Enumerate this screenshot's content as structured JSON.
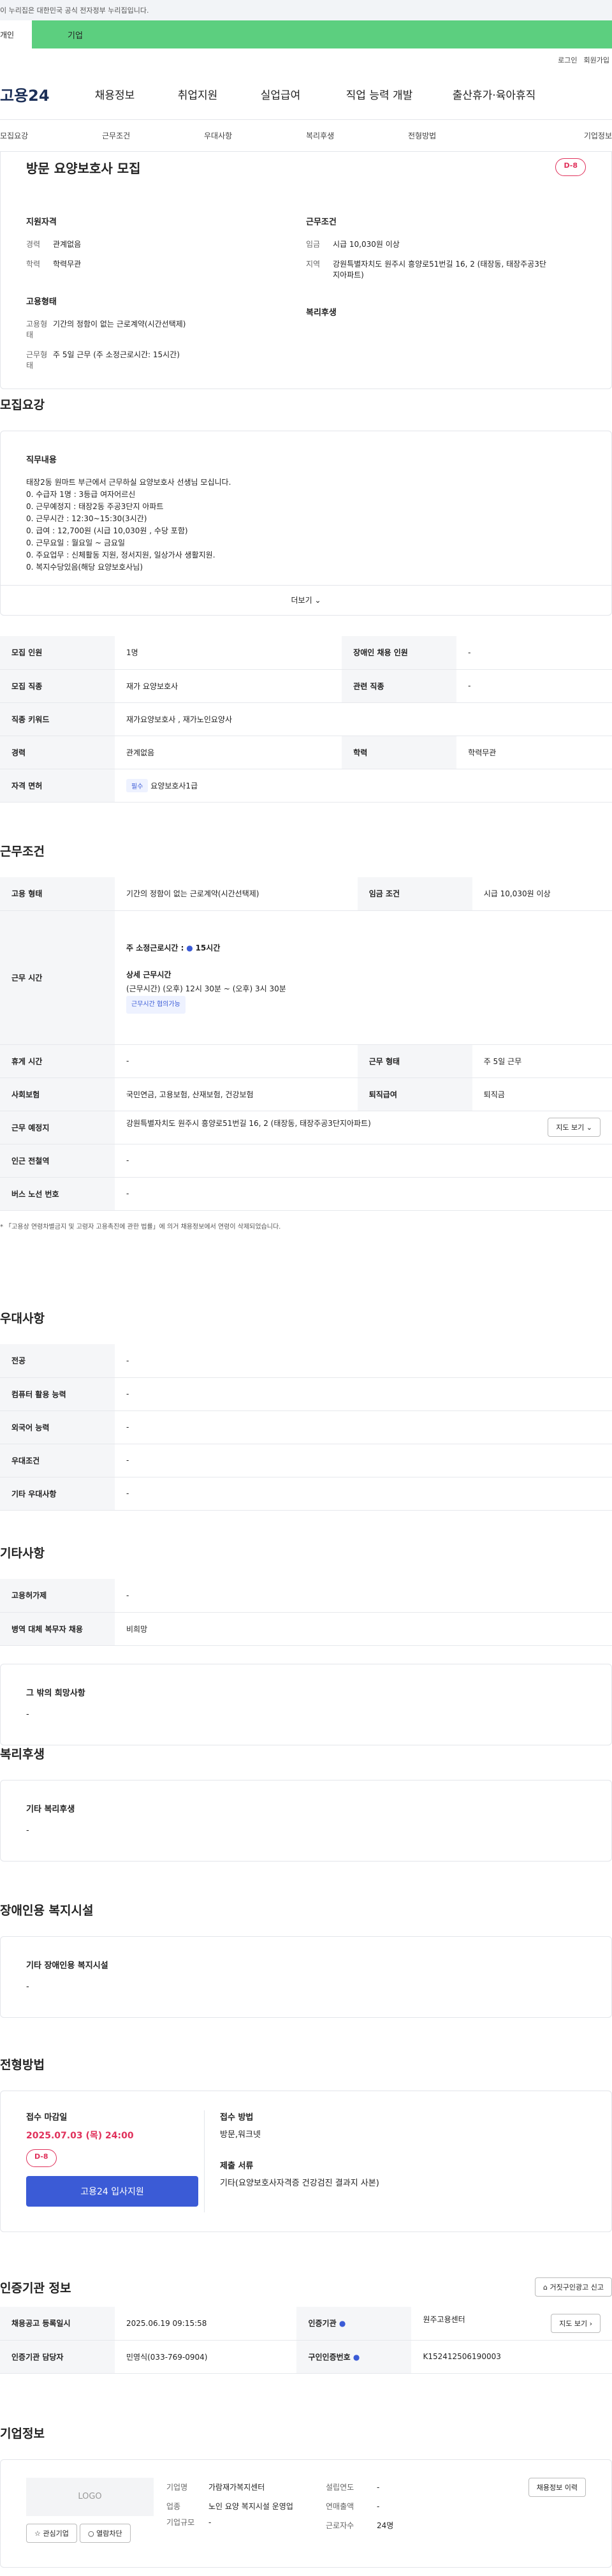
{
  "gov_banner": "이 누리집은 대한민국 공식 전자정부 누리집입니다.",
  "audience": {
    "personal": "개인",
    "company": "기업"
  },
  "util": [
    "로그인",
    "회원가입"
  ],
  "logo": "고용24",
  "gnb": [
    "채용정보",
    "취업지원",
    "실업급여",
    "직업 능력 개발",
    "출산휴가·육아휴직"
  ],
  "snb": [
    "모집요강",
    "근무조건",
    "우대사항",
    "복리후생",
    "전형방법",
    "기업정보"
  ],
  "job": {
    "title": "방문 요양보호사 모집",
    "dday": "D-8",
    "qual_title": "지원자격",
    "career_k": "경력",
    "career": "관계없음",
    "edu_k": "학력",
    "edu": "학력무관",
    "cond_title": "근무조건",
    "wage_k": "임금",
    "wage": "시급 10,030원 이상",
    "region_k": "지역",
    "region": "강원특별자치도 원주시 흥양로51번길 16, 2 (태장동, 태장주공3단지아파트)",
    "emp_title": "고용형태",
    "emptype_k": "고용형태",
    "emptype": "기간의 정함이 없는 근로계약(시간선택제)",
    "worktype_k": "근무형태",
    "worktype": "주 5일 근무 (주 소정근로시간: 15시간)",
    "welfare_title": "복리후생"
  },
  "rec": {
    "title": "모집요강",
    "duty_title": "직무내용",
    "duty": [
      "태장2동 원마트 부근에서 근무하실 요양보호사 선생님 모십니다.",
      "0. 수급자 1명 : 3등급 여자어르신",
      "0. 근무예정지 : 태장2동 주공3단지 아파트",
      "0. 근무시간 : 12:30~15:30(3시간)",
      "0. 급여 : 12,700원 (시급 10,030원 , 수당 포함)",
      "0. 근무요일 : 월요일 ~ 금요일",
      "0. 주요업무 : 신체활동 지원, 정서지원, 일상가사 생활지원.",
      "0. 복지수당있음(해당 요양보호사님)"
    ],
    "more": "더보기",
    "rows": [
      [
        "모집 인원",
        "1명",
        "장애인 채용 인원",
        "-"
      ],
      [
        "모집 직종",
        "재가 요양보호사",
        "관련 직종",
        "-"
      ],
      [
        "직종 키워드",
        "재가요양보호사 , 재가노인요양사",
        "",
        ""
      ],
      [
        "경력",
        "관계없음",
        "학력",
        "학력무관"
      ]
    ],
    "license_k": "자격 면허",
    "license_tag": "필수",
    "license": "요양보호사1급"
  },
  "cond": {
    "title": "근무조건",
    "emptype_k": "고용 형태",
    "emptype": "기간의 정함이 없는 근로계약(시간선택제)",
    "wage_k": "임금 조건",
    "wage": "시급 10,030원 이상",
    "hours_k": "근무 시간",
    "weekly": "주 소정근로시간 :",
    "weekly_v": "15시간",
    "detail_t": "상세 근무시간",
    "detail": "(근무시간) (오후) 12시 30분 ~ (오후) 3시 30분",
    "chip": "근무시간 협의가능",
    "rest_k": "휴게 시간",
    "rest": "-",
    "form_k": "근무 형태",
    "form": "주 5일 근무",
    "ins_k": "사회보험",
    "ins": "국민연금, 고용보험, 산재보험, 건강보험",
    "ret_k": "퇴직급여",
    "ret": "퇴직금",
    "place_k": "근무 예정지",
    "place": "강원특별자치도 원주시 흥양로51번길 16, 2 (태장동, 태장주공3단지아파트)",
    "map": "지도 보기",
    "sub_k": "인근 전철역",
    "sub": "-",
    "bus_k": "버스 노선 번호",
    "bus": "-",
    "note": "* 「고용상 연령차별금지 및 고령자 고용촉진에 관한 법률」에 의거 채용정보에서 연령이 삭제되었습니다."
  },
  "pref": {
    "title": "우대사항",
    "rows": [
      [
        "전공",
        "-"
      ],
      [
        "컴퓨터 활용 능력",
        "-"
      ],
      [
        "외국어 능력",
        "-"
      ],
      [
        "우대조건",
        "-"
      ],
      [
        "기타 우대사항",
        "-"
      ]
    ]
  },
  "etc": {
    "title": "기타사항",
    "rows": [
      [
        "고용허가제",
        "-"
      ],
      [
        "병역 대체 복무자 채용",
        "비희망"
      ]
    ],
    "wish_t": "그 밖의 희망사항",
    "wish": "-"
  },
  "welfare": {
    "title": "복리후생",
    "box_t": "기타 복리후생",
    "box": "-"
  },
  "disab": {
    "title": "장애인용 복지시설",
    "box_t": "기타 장애인용 복지시설",
    "box": "-"
  },
  "sel": {
    "title": "전형방법",
    "deadline_t": "접수 마감일",
    "deadline": "2025.07.03 (목) 24:00",
    "dday": "D-8",
    "apply": "고용24 입사지원",
    "method_t": "접수 방법",
    "method": "방문,워크넷",
    "docs_t": "제출 서류",
    "docs": "기타(요양보호사자격증 건강검진 결과지 사본)"
  },
  "cert": {
    "title": "인증기관 정보",
    "report": "거짓구인광고 신고",
    "reg_k": "채용공고 등록일시",
    "reg": "2025.06.19 09:15:58",
    "org_k": "인증기관",
    "org": "원주고용센터",
    "map": "지도 보기",
    "mgr_k": "인증기관 담당자",
    "mgr": "민영식(033-769-0904)",
    "no_k": "구인인증번호",
    "no": "K152412506190003"
  },
  "comp": {
    "title": "기업정보",
    "logo": "LOGO",
    "fav": "관심기업",
    "block": "열람차단",
    "name_k": "기업명",
    "name": "가람재가복지센터",
    "ind_k": "업종",
    "ind": "노인 요양 복지시설 운영업",
    "size_k": "기업규모",
    "size": "-",
    "est_k": "설립연도",
    "est": "-",
    "rev_k": "연매출액",
    "rev": "-",
    "emp_k": "근로자수",
    "emp": "24명",
    "jobs": "채용정보 이력"
  }
}
